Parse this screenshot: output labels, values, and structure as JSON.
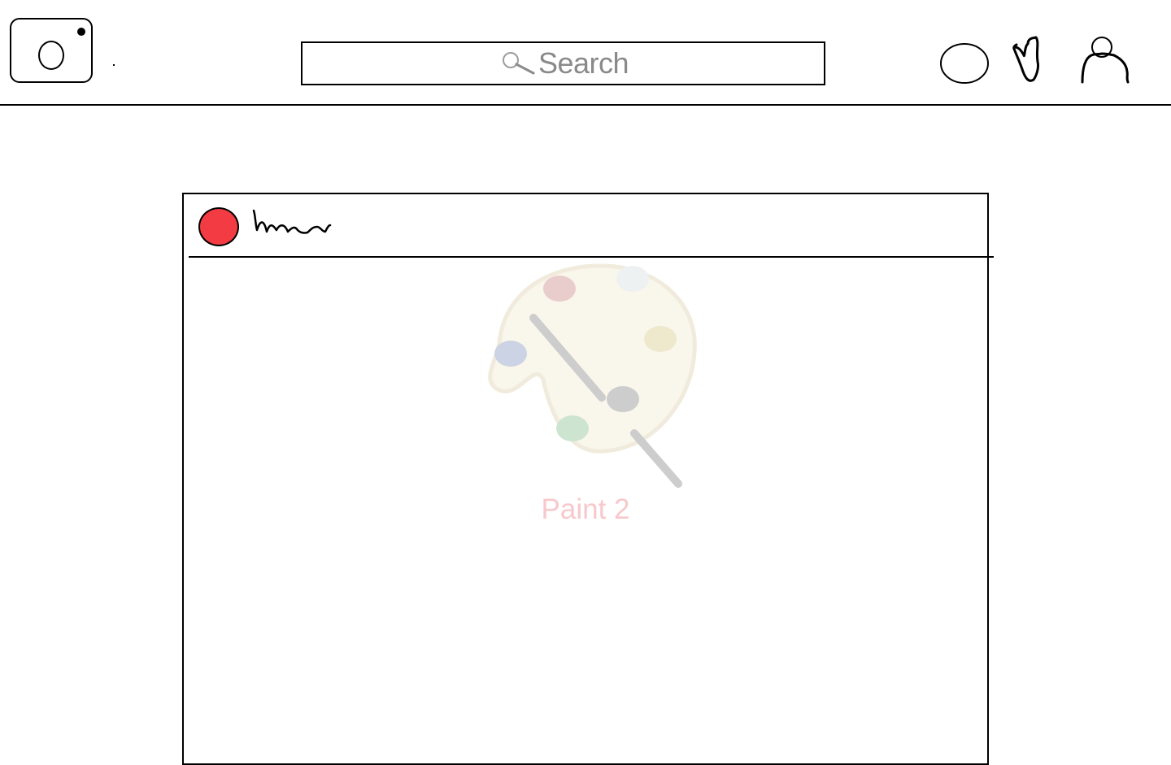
{
  "header": {
    "search": {
      "label": "Search"
    },
    "icons": {
      "logo": "camera-icon",
      "search": "search-icon",
      "activity": "compass-icon",
      "likes": "heart-icon",
      "profile": "profile-icon"
    }
  },
  "post": {
    "avatar_color": "#f23b42",
    "media": {
      "image": "paint-palette",
      "caption": "Paint 2"
    }
  },
  "colors": {
    "avatar": "#f23b42",
    "search_text": "#8a8a8a",
    "caption_text": "#f7c8cc"
  }
}
